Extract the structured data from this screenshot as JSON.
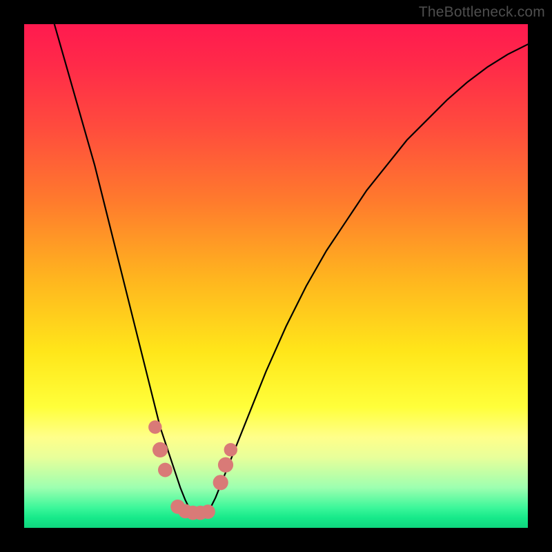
{
  "watermark": "TheBottleneck.com",
  "colors": {
    "frame": "#000000",
    "gradient_top": "#ff1a4f",
    "gradient_mid": "#ffe61a",
    "gradient_bottom": "#0fd67e",
    "curve": "#000000",
    "markers": "#d97a77"
  },
  "chart_data": {
    "type": "line",
    "title": "",
    "xlabel": "",
    "ylabel": "",
    "xlim": [
      0,
      100
    ],
    "ylim": [
      0,
      100
    ],
    "note": "Axes unlabeled; values are relative to plot area. y=100 top, y=0 bottom. Single V-shaped curve with minimum near x≈33.",
    "series": [
      {
        "name": "curve",
        "x": [
          6,
          8,
          10,
          12,
          14,
          16,
          18,
          20,
          22,
          24,
          25,
          26,
          27,
          28,
          29,
          30,
          31,
          32,
          33,
          34,
          35,
          36,
          37,
          38,
          39,
          40,
          42,
          44,
          46,
          48,
          52,
          56,
          60,
          64,
          68,
          72,
          76,
          80,
          84,
          88,
          92,
          96,
          100
        ],
        "y": [
          100,
          93,
          86,
          79,
          72,
          64,
          56,
          48,
          40,
          32,
          28,
          24,
          20,
          17,
          14,
          11,
          8,
          5.5,
          3.5,
          3,
          3,
          3.2,
          4,
          6,
          8.5,
          11,
          16,
          21,
          26,
          31,
          40,
          48,
          55,
          61,
          67,
          72,
          77,
          81,
          85,
          88.5,
          91.5,
          94,
          96
        ]
      }
    ],
    "markers": [
      {
        "x": 26.0,
        "y": 20.0,
        "r": 1.4
      },
      {
        "x": 27.0,
        "y": 15.5,
        "r": 1.6
      },
      {
        "x": 28.0,
        "y": 11.5,
        "r": 1.5
      },
      {
        "x": 30.5,
        "y": 4.2,
        "r": 1.5
      },
      {
        "x": 32.0,
        "y": 3.3,
        "r": 1.5
      },
      {
        "x": 33.5,
        "y": 3.0,
        "r": 1.5
      },
      {
        "x": 35.0,
        "y": 3.0,
        "r": 1.5
      },
      {
        "x": 36.5,
        "y": 3.2,
        "r": 1.5
      },
      {
        "x": 39.0,
        "y": 9.0,
        "r": 1.6
      },
      {
        "x": 40.0,
        "y": 12.5,
        "r": 1.6
      },
      {
        "x": 41.0,
        "y": 15.5,
        "r": 1.4
      }
    ]
  }
}
